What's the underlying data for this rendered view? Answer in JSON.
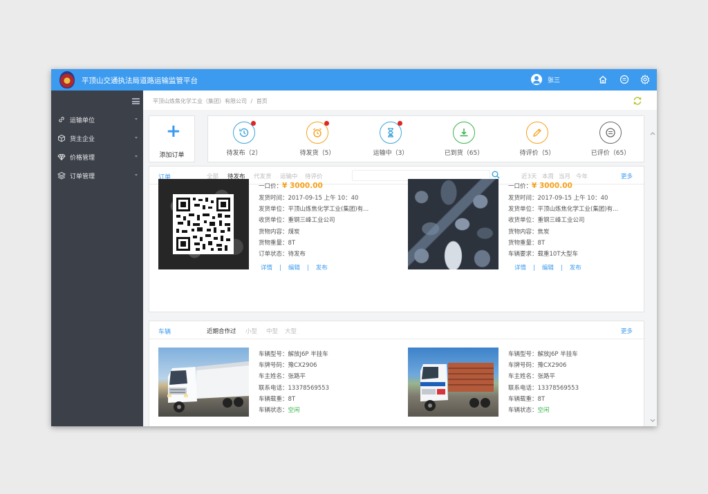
{
  "app": {
    "title": "平顶山交通执法局道路运输监管平台",
    "user": "张三"
  },
  "sidebar": {
    "items": [
      {
        "label": "运输单位",
        "icon": "link-icon"
      },
      {
        "label": "货主企业",
        "icon": "cube-icon"
      },
      {
        "label": "价格管理",
        "icon": "diamond-icon"
      },
      {
        "label": "订单管理",
        "icon": "layers-icon"
      }
    ]
  },
  "breadcrumb": {
    "company": "平顶山炼焦化学工业（集团）有限公司",
    "sep": "/",
    "page": "首页"
  },
  "add_order": {
    "plus": "+",
    "label": "添加订单"
  },
  "statuses": [
    {
      "label": "待发布（2）",
      "color": "#3aa3d8",
      "dot": true,
      "icon": "clock-history-icon"
    },
    {
      "label": "待发货（5）",
      "color": "#f5a11a",
      "dot": true,
      "icon": "alarm-clock-icon"
    },
    {
      "label": "运输中（3）",
      "color": "#3aa3d8",
      "dot": true,
      "icon": "hourglass-icon"
    },
    {
      "label": "已到货（65）",
      "color": "#34b34a",
      "dot": false,
      "icon": "download-icon"
    },
    {
      "label": "待评价（5）",
      "color": "#f5a11a",
      "dot": false,
      "icon": "pencil-icon"
    },
    {
      "label": "已评价（65）",
      "color": "#666666",
      "dot": false,
      "icon": "comment-icon"
    }
  ],
  "orders_panel": {
    "title": "订单",
    "filters": [
      "全部",
      "待发布",
      "代发货",
      "运输中",
      "待评价"
    ],
    "active_filter": "待发布",
    "time_filters": [
      "近3天",
      "本周",
      "当月",
      "今年"
    ],
    "more": "更多",
    "orders": [
      {
        "price_label": "一口价：",
        "price": "¥ 3000.00",
        "lines": [
          "发货时间：2017-09-15  上午  10：40",
          "发货单位：平顶山炼焦化学工业(集团)有...",
          "收货单位：重钢三峰工业公司",
          "货物内容：煤炭",
          "货物重量：8T",
          "订单状态：待发布"
        ],
        "actions": [
          "详情",
          "编辑",
          "发布"
        ]
      },
      {
        "price_label": "一口价：",
        "price": "¥ 3000.00",
        "lines": [
          "发货时间：2017-09-15  上午  10：40",
          "发货单位：平顶山炼焦化学工业(集团)有...",
          "收货单位：重钢三峰工业公司",
          "货物内容：焦炭",
          "货物重量：8T",
          "车辆要求：载重10T大型车"
        ],
        "actions": [
          "详情",
          "编辑",
          "发布"
        ]
      }
    ]
  },
  "vehicles_panel": {
    "title": "车辆",
    "filters": [
      "近期合作过",
      "小型",
      "中型",
      "大型"
    ],
    "active_filter": "近期合作过",
    "more": "更多",
    "vehicles": [
      {
        "lines": [
          "车辆型号：解放J6P 半挂车",
          "车牌号码：豫CX2906",
          "车主姓名：张路平",
          "联系电话：13378569553",
          "车辆载重：8T"
        ],
        "status_label": "车辆状态：",
        "status": "空闲"
      },
      {
        "lines": [
          "车辆型号：解放J6P 半挂车",
          "车牌号码：豫CX2906",
          "车主姓名：张路平",
          "联系电话：13378569553",
          "车辆载重：8T"
        ],
        "status_label": "车辆状态：",
        "status": "空闲"
      }
    ]
  }
}
